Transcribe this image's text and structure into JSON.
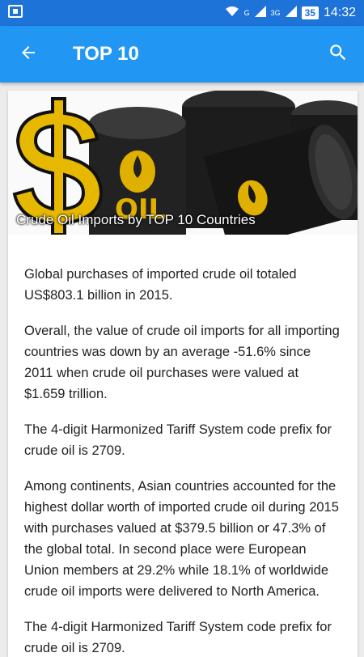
{
  "statusbar": {
    "battery": "35",
    "time": "14:32",
    "signal1_label": "G",
    "signal2_label": "3G"
  },
  "appbar": {
    "title": "TOP 10"
  },
  "article": {
    "hero_caption": "Crude Oil Imports by TOP 10 Countries",
    "barrel_label": "OIL",
    "paragraphs": [
      "Global purchases of imported crude oil totaled US$803.1 billion in 2015.",
      "Overall, the value of crude oil imports for all importing countries was down by an average -51.6% since 2011 when crude oil purchases were valued at $1.659 trillion.",
      "The 4-digit Harmonized Tariff System code prefix for crude oil is 2709.",
      "Among continents, Asian countries accounted for the highest dollar worth of imported crude oil during 2015 with purchases valued at $379.5 billion or 47.3% of the global total. In second place were European Union members at 29.2% while 18.1% of worldwide crude oil imports were delivered to North America.",
      "The 4-digit Harmonized Tariff System code prefix for crude oil is 2709."
    ]
  }
}
